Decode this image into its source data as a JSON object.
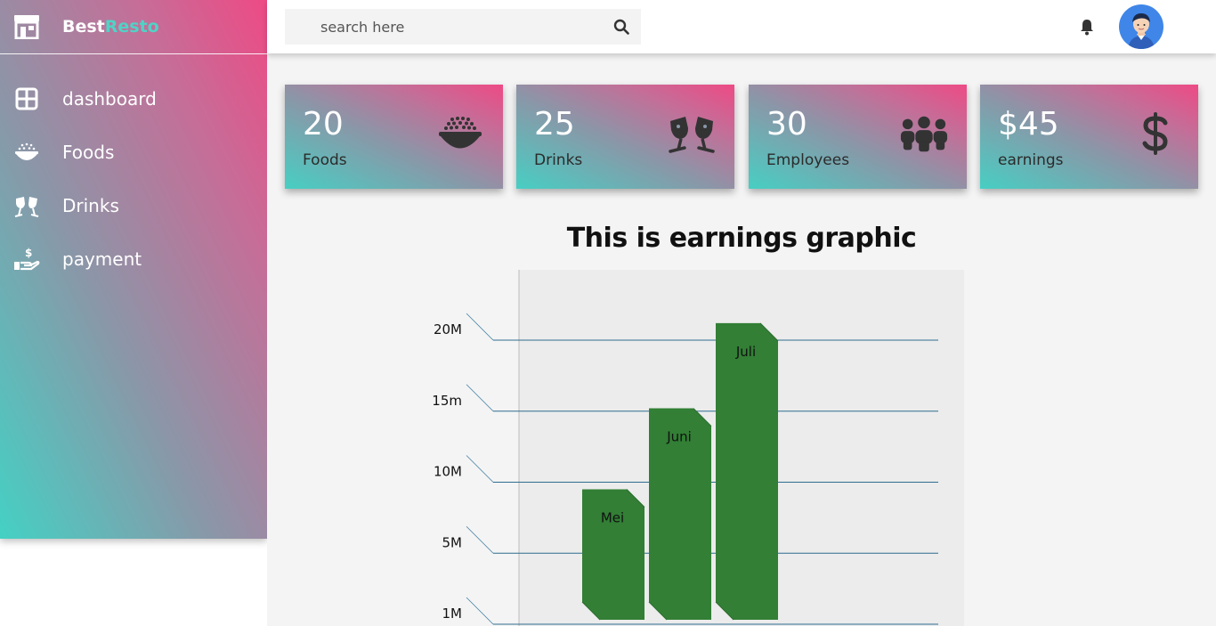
{
  "brand": {
    "name_part1": "Best",
    "name_part2": "Resto",
    "icon": "store-icon"
  },
  "sidebar": {
    "items": [
      {
        "label": "dashboard",
        "icon": "dashboard-grid-icon"
      },
      {
        "label": "Foods",
        "icon": "food-bowl-icon"
      },
      {
        "label": "Drinks",
        "icon": "cheers-glasses-icon"
      },
      {
        "label": "payment",
        "icon": "hand-dollar-icon"
      }
    ]
  },
  "topbar": {
    "search": {
      "placeholder": "search here",
      "value": "",
      "icon": "search-icon"
    },
    "notification_icon": "bell-icon",
    "avatar_icon": "user-avatar"
  },
  "cards": [
    {
      "value": "20",
      "label": "Foods",
      "icon": "food-bowl-icon"
    },
    {
      "value": "25",
      "label": "Drinks",
      "icon": "cheers-glasses-icon"
    },
    {
      "value": "30",
      "label": "Employees",
      "icon": "people-group-icon"
    },
    {
      "value": "$45",
      "label": "earnings",
      "icon": "dollar-sign-icon"
    }
  ],
  "colors": {
    "brand_accent": "#4fd3c6",
    "gradient_pink": "#ee4a85",
    "gradient_teal": "#44d1c4",
    "bar_green": "#327f35",
    "grid_line": "#3f6f8f"
  },
  "chart_data": {
    "type": "bar",
    "title": "This is earnings graphic",
    "y_tick_labels": [
      "1M",
      "5M",
      "10M",
      "15m",
      "20M"
    ],
    "y_tick_values": [
      0,
      5,
      10,
      15,
      20
    ],
    "categories": [
      "Mei",
      "Juni",
      "Juli"
    ],
    "values": [
      9.5,
      15.2,
      21.2
    ],
    "ylim": [
      0,
      20
    ],
    "grid": true,
    "style": "3d"
  }
}
